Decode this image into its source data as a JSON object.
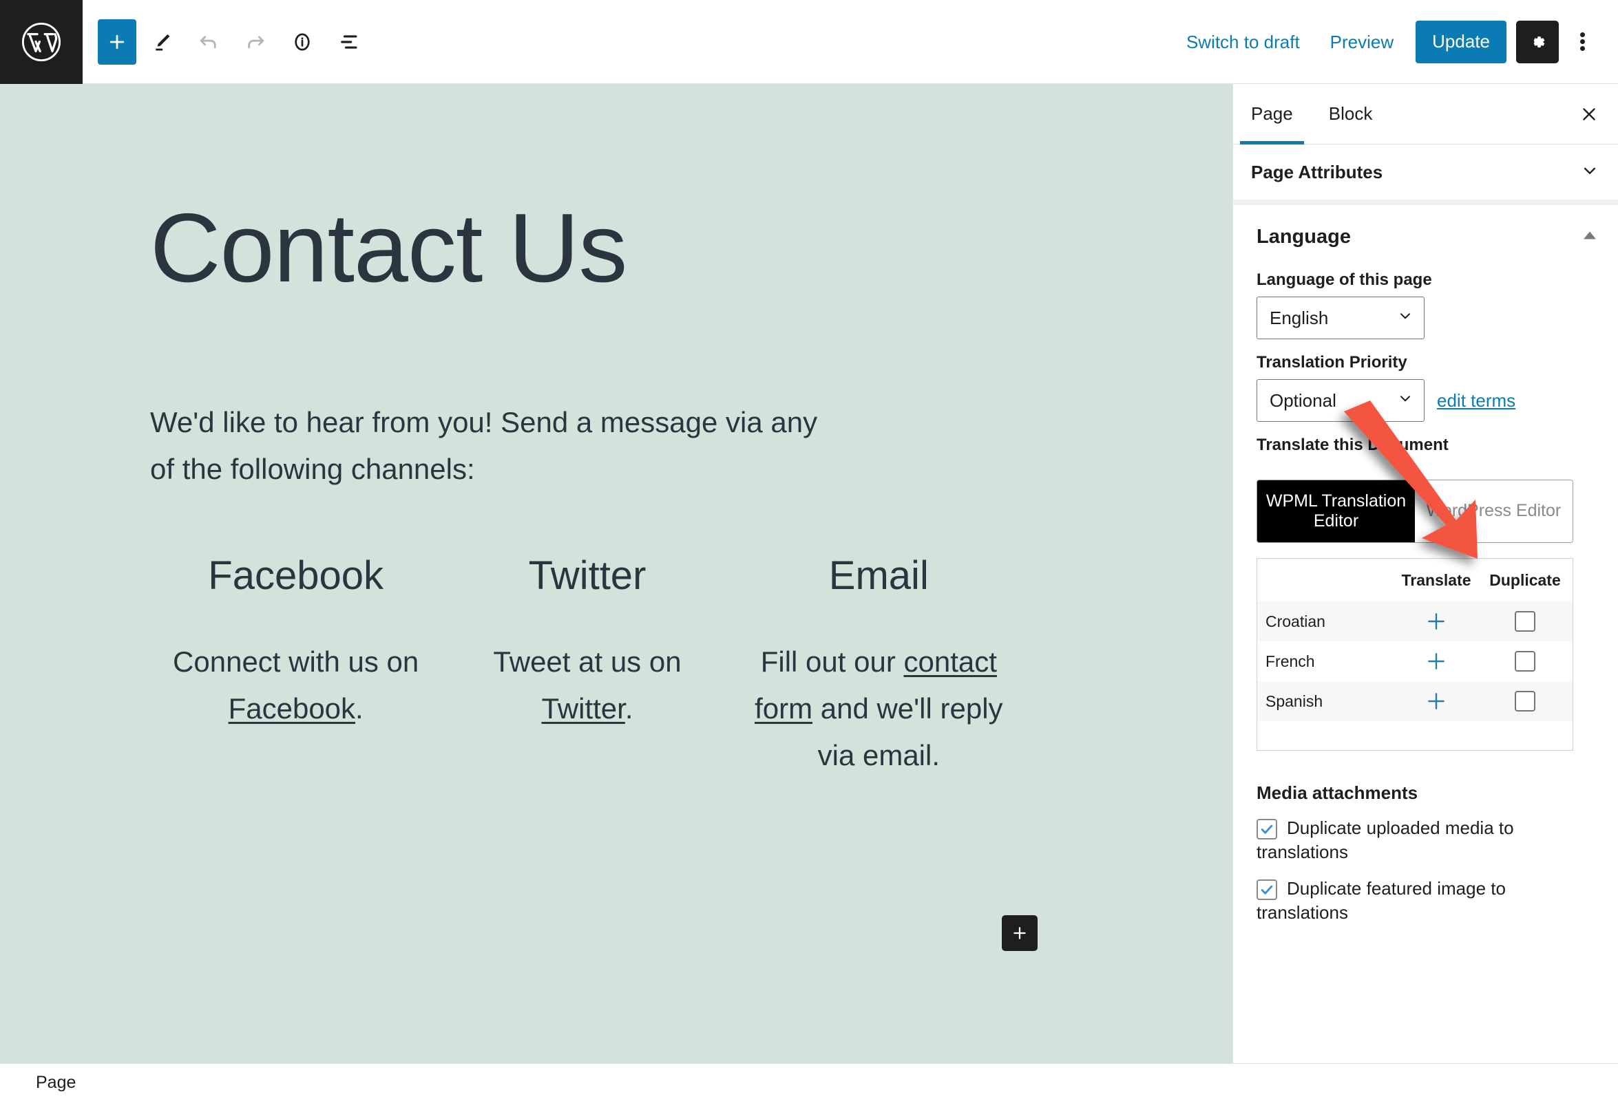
{
  "toolbar": {
    "logo_icon": "wordpress-logo-icon",
    "add_block_label": "+",
    "tools": [
      {
        "name": "add-block-button",
        "icon": "plus-icon"
      },
      {
        "name": "edit-tool-button",
        "icon": "pencil-icon"
      },
      {
        "name": "undo-button",
        "icon": "undo-icon"
      },
      {
        "name": "redo-button",
        "icon": "redo-icon"
      },
      {
        "name": "details-button",
        "icon": "info-circle-icon"
      },
      {
        "name": "list-view-button",
        "icon": "list-view-icon"
      }
    ],
    "switch_to_draft": "Switch to draft",
    "preview": "Preview",
    "update": "Update",
    "settings_icon": "gear-icon",
    "more_options_icon": "kebab-menu-icon"
  },
  "canvas": {
    "title": "Contact Us",
    "intro": "We'd like to hear from you! Send a message via any of the following channels:",
    "columns": [
      {
        "heading": "Facebook",
        "text_before": "Connect with us on ",
        "link": "Facebook",
        "text_after": "."
      },
      {
        "heading": "Twitter",
        "text_before": "Tweet at us on ",
        "link": "Twitter",
        "text_after": "."
      },
      {
        "heading": "Email",
        "text_before": "Fill out our ",
        "link": "contact form",
        "text_after": " and we'll reply via email."
      }
    ],
    "add_block_icon": "plus-icon"
  },
  "sidebar": {
    "tabs": [
      {
        "label": "Page",
        "active": true
      },
      {
        "label": "Block",
        "active": false
      }
    ],
    "close_icon": "close-icon",
    "page_attributes": {
      "title": "Page Attributes",
      "chevron_icon": "chevron-down-icon"
    },
    "language": {
      "title": "Language",
      "collapse_icon": "triangle-up-icon",
      "language_label": "Language of this page",
      "language_value": "English",
      "priority_label": "Translation Priority",
      "priority_value": "Optional",
      "edit_terms_link": "edit terms",
      "translate_doc_label": "Translate this Document",
      "editor_toggle": {
        "selected": "WPML Translation Editor",
        "unselected": "WordPress Editor"
      },
      "table": {
        "columns": [
          "",
          "Translate",
          "Duplicate"
        ],
        "rows": [
          {
            "language": "Croatian",
            "translate_icon": "plus-icon",
            "duplicate_checked": false
          },
          {
            "language": "French",
            "translate_icon": "plus-icon",
            "duplicate_checked": false
          },
          {
            "language": "Spanish",
            "translate_icon": "plus-icon",
            "duplicate_checked": false
          }
        ]
      }
    },
    "media": {
      "title": "Media attachments",
      "options": [
        {
          "label": "Duplicate uploaded media to translations",
          "checked": true
        },
        {
          "label": "Duplicate featured image to translations",
          "checked": true
        }
      ]
    }
  },
  "bottombar": {
    "breadcrumb": "Page"
  },
  "annotation": {
    "type": "arrow",
    "color": "#f4553f",
    "points_to": "WordPress Editor"
  },
  "colors": {
    "accent_blue": "#0b7cb3",
    "dark": "#1e1e1e",
    "canvas_bg": "#d4e2dc",
    "canvas_text": "#2b3540",
    "annotation_red": "#f4553f"
  }
}
